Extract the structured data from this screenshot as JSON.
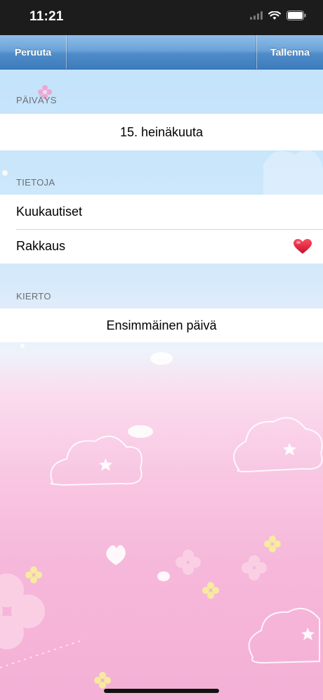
{
  "status_bar": {
    "time": "11:21",
    "icons": [
      "signal-icon",
      "wifi-icon",
      "battery-icon"
    ]
  },
  "navbar": {
    "cancel_label": "Peruuta",
    "save_label": "Tallenna"
  },
  "sections": {
    "date": {
      "header": "PÄIVÄYS",
      "value": "15. heinäkuuta"
    },
    "info": {
      "header": "TIETOJA",
      "items": [
        {
          "label": "Kuukautiset",
          "icon": ""
        },
        {
          "label": "Rakkaus",
          "icon": "heart-icon"
        }
      ]
    },
    "cycle": {
      "header": "KIERTO",
      "value": "Ensimmäinen päivä"
    }
  },
  "colors": {
    "navbar_blue": "#4f8cc8",
    "heart_red": "#e0203a",
    "section_header_gray": "#6d6d72"
  }
}
